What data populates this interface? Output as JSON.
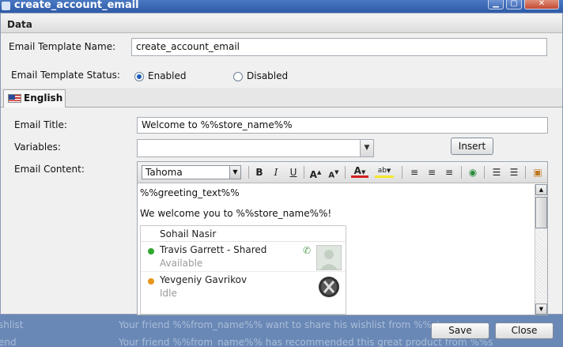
{
  "window": {
    "title": "create_account_email"
  },
  "section": {
    "title": "Data"
  },
  "form": {
    "template_name_label": "Email Template Name:",
    "template_name_value": "create_account_email",
    "template_status_label": "Email Template Status:",
    "status_enabled": "Enabled",
    "status_disabled": "Disabled",
    "status_selected": "Enabled"
  },
  "tabs": [
    {
      "label": "English"
    }
  ],
  "email": {
    "title_label": "Email Title:",
    "title_value": "Welcome to %%store_name%%",
    "variables_label": "Variables:",
    "variables_value": "",
    "insert_label": "Insert",
    "content_label": "Email Content:",
    "font": "Tahoma",
    "content_lines": [
      "%%greeting_text%%",
      "We welcome you to %%store_name%%!"
    ]
  },
  "contacts": {
    "header": "Sohail Nasir",
    "items": [
      {
        "name": "Travis Garrett - Shared",
        "status": "Available",
        "status_color": "#2fa82f"
      },
      {
        "name": "Yevgeniy Gavrikov",
        "status": "Idle",
        "status_color": "#e8961c"
      }
    ]
  },
  "background_rows": [
    {
      "col1": "shlist",
      "col2": "Your friend %%from_name%% want to share his wishlist from %%store"
    },
    {
      "col1": "end",
      "col2": "Your friend %%from_name%% has recommended this great product from %%s"
    }
  ],
  "footer": {
    "save_label": "Save",
    "close_label": "Close"
  },
  "colors": {
    "titlebar": "#2e5aa8",
    "dialog": "#f0f0f0",
    "accent": "#1a5bb8"
  }
}
